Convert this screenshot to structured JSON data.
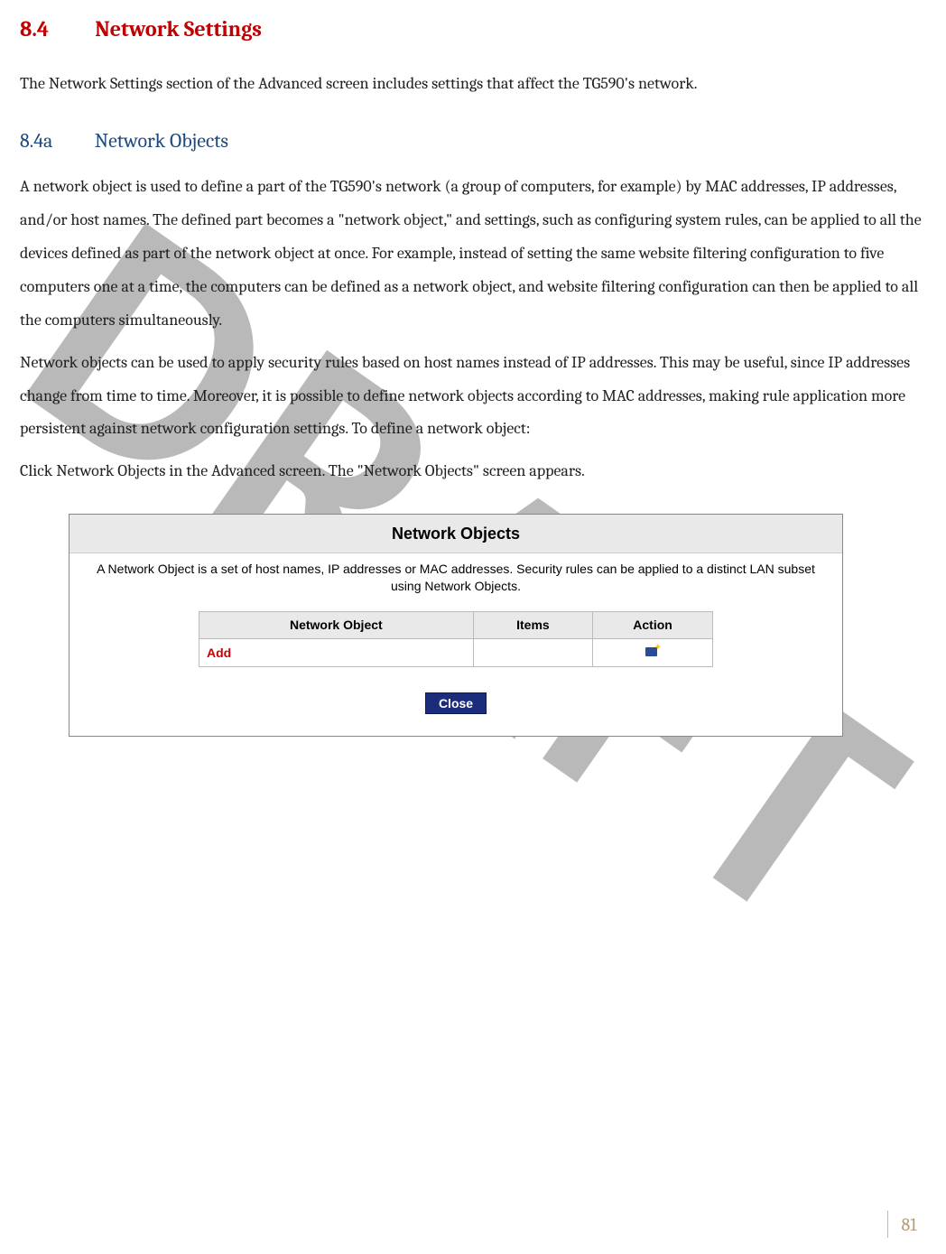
{
  "watermark": "DRAFT",
  "section": {
    "number": "8.4",
    "title": "Network Settings",
    "intro": "The Network Settings section of the Advanced screen includes settings that affect the TG590's network."
  },
  "subsection": {
    "number": "8.4a",
    "title": "Network Objects",
    "para1": "A network object is used to define a part of the TG590's network (a group of computers, for example) by MAC addresses, IP addresses, and/or host names. The defined part becomes a \"network object,\" and settings, such as configuring system rules, can be applied to all the devices defined as part of the network object at once. For example, instead of setting the same website filtering configuration to five computers one at a time, the computers can be defined as a network object, and website filtering configuration can then be applied to all the computers simultaneously.",
    "para2": "Network objects can be used to apply security rules based on host names instead of IP addresses. This may be useful, since IP addresses change from time to time. Moreover, it is possible to define network objects according to MAC addresses, making rule application more persistent against network configuration settings. To define a network object:",
    "para3": "Click Network Objects in the Advanced screen. The \"Network Objects\" screen appears."
  },
  "panel": {
    "title": "Network Objects",
    "description": "A Network Object is a set of host names, IP addresses or MAC addresses. Security rules can be applied to a distinct LAN subset using Network Objects.",
    "headers": {
      "object": "Network Object",
      "items": "Items",
      "action": "Action"
    },
    "add_label": "Add",
    "close_label": "Close"
  },
  "page_number": "81"
}
